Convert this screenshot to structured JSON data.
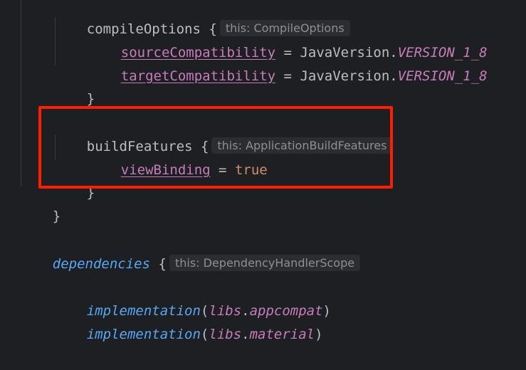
{
  "code": {
    "compile_options": {
      "name": "compileOptions",
      "brace": "{",
      "hint": "this: CompileOptions"
    },
    "source_compat": {
      "prop": "sourceCompatibility",
      "op": " = ",
      "cls": "JavaVersion.",
      "const": "VERSION_1_8"
    },
    "target_compat": {
      "prop": "targetCompatibility",
      "op": " = ",
      "cls": "JavaVersion.",
      "const": "VERSION_1_8"
    },
    "close_brace_1": "}",
    "build_features": {
      "name": "buildFeatures",
      "brace": "{",
      "hint": "this: ApplicationBuildFeatures"
    },
    "view_binding": {
      "prop": "viewBinding",
      "op": " = ",
      "value": "true"
    },
    "close_brace_2": "}",
    "close_brace_3": "}",
    "dependencies": {
      "name": "dependencies",
      "brace": "{",
      "hint": "this: DependencyHandlerScope"
    },
    "impl_1": {
      "fn": "implementation",
      "open": "(",
      "libs": "libs",
      "dot": ".",
      "item": "appcompat",
      "close": ")"
    },
    "impl_2": {
      "fn": "implementation",
      "open": "(",
      "libs": "libs",
      "dot": ".",
      "item": "material",
      "close": ")"
    }
  },
  "colors": {
    "background": "#1e1f22",
    "highlight_border": "#ff1f00",
    "property": "#c77dbb",
    "keyword": "#cf8e6d",
    "function": "#56a8f5",
    "text": "#bcbec4",
    "hint_text": "#8c8f94",
    "hint_bg": "#2b2d30"
  }
}
